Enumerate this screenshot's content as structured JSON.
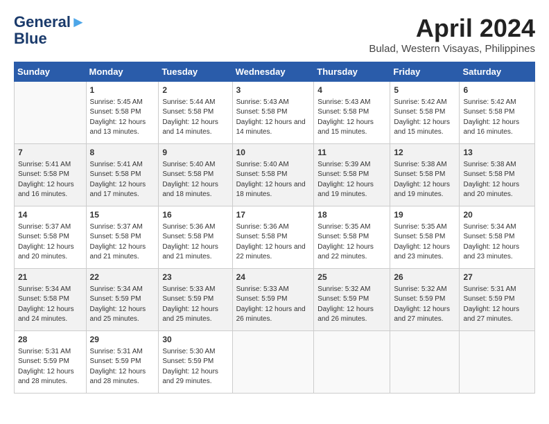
{
  "header": {
    "logo_line1": "General",
    "logo_line2": "Blue",
    "month_title": "April 2024",
    "location": "Bulad, Western Visayas, Philippines"
  },
  "weekdays": [
    "Sunday",
    "Monday",
    "Tuesday",
    "Wednesday",
    "Thursday",
    "Friday",
    "Saturday"
  ],
  "weeks": [
    [
      {
        "day": "",
        "sunrise": "",
        "sunset": "",
        "daylight": ""
      },
      {
        "day": "1",
        "sunrise": "5:45 AM",
        "sunset": "5:58 PM",
        "daylight": "12 hours and 13 minutes."
      },
      {
        "day": "2",
        "sunrise": "5:44 AM",
        "sunset": "5:58 PM",
        "daylight": "12 hours and 14 minutes."
      },
      {
        "day": "3",
        "sunrise": "5:43 AM",
        "sunset": "5:58 PM",
        "daylight": "12 hours and 14 minutes."
      },
      {
        "day": "4",
        "sunrise": "5:43 AM",
        "sunset": "5:58 PM",
        "daylight": "12 hours and 15 minutes."
      },
      {
        "day": "5",
        "sunrise": "5:42 AM",
        "sunset": "5:58 PM",
        "daylight": "12 hours and 15 minutes."
      },
      {
        "day": "6",
        "sunrise": "5:42 AM",
        "sunset": "5:58 PM",
        "daylight": "12 hours and 16 minutes."
      }
    ],
    [
      {
        "day": "7",
        "sunrise": "5:41 AM",
        "sunset": "5:58 PM",
        "daylight": "12 hours and 16 minutes."
      },
      {
        "day": "8",
        "sunrise": "5:41 AM",
        "sunset": "5:58 PM",
        "daylight": "12 hours and 17 minutes."
      },
      {
        "day": "9",
        "sunrise": "5:40 AM",
        "sunset": "5:58 PM",
        "daylight": "12 hours and 18 minutes."
      },
      {
        "day": "10",
        "sunrise": "5:40 AM",
        "sunset": "5:58 PM",
        "daylight": "12 hours and 18 minutes."
      },
      {
        "day": "11",
        "sunrise": "5:39 AM",
        "sunset": "5:58 PM",
        "daylight": "12 hours and 19 minutes."
      },
      {
        "day": "12",
        "sunrise": "5:38 AM",
        "sunset": "5:58 PM",
        "daylight": "12 hours and 19 minutes."
      },
      {
        "day": "13",
        "sunrise": "5:38 AM",
        "sunset": "5:58 PM",
        "daylight": "12 hours and 20 minutes."
      }
    ],
    [
      {
        "day": "14",
        "sunrise": "5:37 AM",
        "sunset": "5:58 PM",
        "daylight": "12 hours and 20 minutes."
      },
      {
        "day": "15",
        "sunrise": "5:37 AM",
        "sunset": "5:58 PM",
        "daylight": "12 hours and 21 minutes."
      },
      {
        "day": "16",
        "sunrise": "5:36 AM",
        "sunset": "5:58 PM",
        "daylight": "12 hours and 21 minutes."
      },
      {
        "day": "17",
        "sunrise": "5:36 AM",
        "sunset": "5:58 PM",
        "daylight": "12 hours and 22 minutes."
      },
      {
        "day": "18",
        "sunrise": "5:35 AM",
        "sunset": "5:58 PM",
        "daylight": "12 hours and 22 minutes."
      },
      {
        "day": "19",
        "sunrise": "5:35 AM",
        "sunset": "5:58 PM",
        "daylight": "12 hours and 23 minutes."
      },
      {
        "day": "20",
        "sunrise": "5:34 AM",
        "sunset": "5:58 PM",
        "daylight": "12 hours and 23 minutes."
      }
    ],
    [
      {
        "day": "21",
        "sunrise": "5:34 AM",
        "sunset": "5:58 PM",
        "daylight": "12 hours and 24 minutes."
      },
      {
        "day": "22",
        "sunrise": "5:34 AM",
        "sunset": "5:59 PM",
        "daylight": "12 hours and 25 minutes."
      },
      {
        "day": "23",
        "sunrise": "5:33 AM",
        "sunset": "5:59 PM",
        "daylight": "12 hours and 25 minutes."
      },
      {
        "day": "24",
        "sunrise": "5:33 AM",
        "sunset": "5:59 PM",
        "daylight": "12 hours and 26 minutes."
      },
      {
        "day": "25",
        "sunrise": "5:32 AM",
        "sunset": "5:59 PM",
        "daylight": "12 hours and 26 minutes."
      },
      {
        "day": "26",
        "sunrise": "5:32 AM",
        "sunset": "5:59 PM",
        "daylight": "12 hours and 27 minutes."
      },
      {
        "day": "27",
        "sunrise": "5:31 AM",
        "sunset": "5:59 PM",
        "daylight": "12 hours and 27 minutes."
      }
    ],
    [
      {
        "day": "28",
        "sunrise": "5:31 AM",
        "sunset": "5:59 PM",
        "daylight": "12 hours and 28 minutes."
      },
      {
        "day": "29",
        "sunrise": "5:31 AM",
        "sunset": "5:59 PM",
        "daylight": "12 hours and 28 minutes."
      },
      {
        "day": "30",
        "sunrise": "5:30 AM",
        "sunset": "5:59 PM",
        "daylight": "12 hours and 29 minutes."
      },
      {
        "day": "",
        "sunrise": "",
        "sunset": "",
        "daylight": ""
      },
      {
        "day": "",
        "sunrise": "",
        "sunset": "",
        "daylight": ""
      },
      {
        "day": "",
        "sunrise": "",
        "sunset": "",
        "daylight": ""
      },
      {
        "day": "",
        "sunrise": "",
        "sunset": "",
        "daylight": ""
      }
    ]
  ]
}
